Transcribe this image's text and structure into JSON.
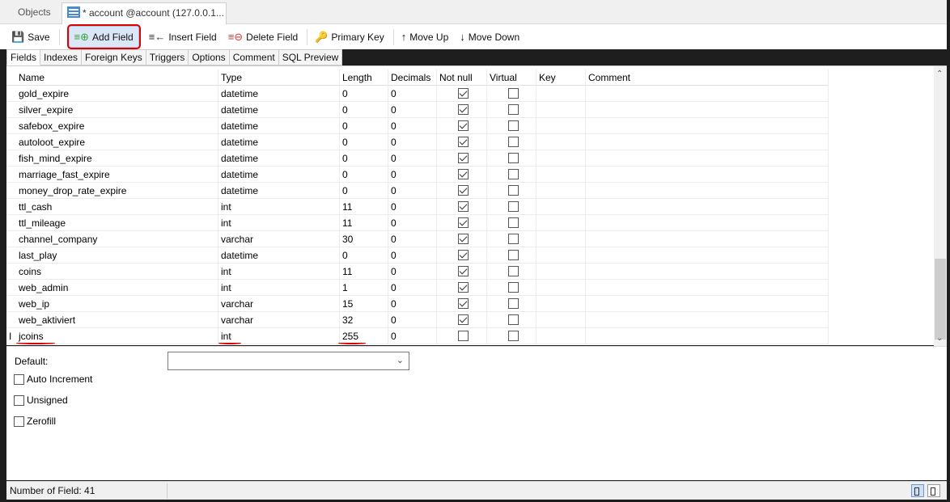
{
  "tabs": {
    "objects_label": "Objects",
    "active_label": "* account @account (127.0.0.1..."
  },
  "toolbar": {
    "save": "Save",
    "add_field": "Add Field",
    "insert_field": "Insert Field",
    "delete_field": "Delete Field",
    "primary_key": "Primary Key",
    "move_up": "Move Up",
    "move_down": "Move Down"
  },
  "subtabs": [
    "Fields",
    "Indexes",
    "Foreign Keys",
    "Triggers",
    "Options",
    "Comment",
    "SQL Preview"
  ],
  "grid": {
    "headers": {
      "name": "Name",
      "type": "Type",
      "length": "Length",
      "decimals": "Decimals",
      "not_null": "Not null",
      "virtual": "Virtual",
      "key": "Key",
      "comment": "Comment"
    },
    "rows": [
      {
        "name": "gold_expire",
        "type": "datetime",
        "length": "0",
        "decimals": "0",
        "not_null": true,
        "virtual": false
      },
      {
        "name": "silver_expire",
        "type": "datetime",
        "length": "0",
        "decimals": "0",
        "not_null": true,
        "virtual": false
      },
      {
        "name": "safebox_expire",
        "type": "datetime",
        "length": "0",
        "decimals": "0",
        "not_null": true,
        "virtual": false
      },
      {
        "name": "autoloot_expire",
        "type": "datetime",
        "length": "0",
        "decimals": "0",
        "not_null": true,
        "virtual": false
      },
      {
        "name": "fish_mind_expire",
        "type": "datetime",
        "length": "0",
        "decimals": "0",
        "not_null": true,
        "virtual": false
      },
      {
        "name": "marriage_fast_expire",
        "type": "datetime",
        "length": "0",
        "decimals": "0",
        "not_null": true,
        "virtual": false
      },
      {
        "name": "money_drop_rate_expire",
        "type": "datetime",
        "length": "0",
        "decimals": "0",
        "not_null": true,
        "virtual": false
      },
      {
        "name": "ttl_cash",
        "type": "int",
        "length": "11",
        "decimals": "0",
        "not_null": true,
        "virtual": false
      },
      {
        "name": "ttl_mileage",
        "type": "int",
        "length": "11",
        "decimals": "0",
        "not_null": true,
        "virtual": false
      },
      {
        "name": "channel_company",
        "type": "varchar",
        "length": "30",
        "decimals": "0",
        "not_null": true,
        "virtual": false
      },
      {
        "name": "last_play",
        "type": "datetime",
        "length": "0",
        "decimals": "0",
        "not_null": true,
        "virtual": false
      },
      {
        "name": "coins",
        "type": "int",
        "length": "11",
        "decimals": "0",
        "not_null": true,
        "virtual": false
      },
      {
        "name": "web_admin",
        "type": "int",
        "length": "1",
        "decimals": "0",
        "not_null": true,
        "virtual": false
      },
      {
        "name": "web_ip",
        "type": "varchar",
        "length": "15",
        "decimals": "0",
        "not_null": true,
        "virtual": false
      },
      {
        "name": "web_aktiviert",
        "type": "varchar",
        "length": "32",
        "decimals": "0",
        "not_null": true,
        "virtual": false
      },
      {
        "name": "jcoins",
        "type": "int",
        "length": "255",
        "decimals": "0",
        "not_null": false,
        "virtual": false
      }
    ],
    "current_row_marker": "I"
  },
  "properties": {
    "default_label": "Default:",
    "default_value": "",
    "auto_increment": "Auto Increment",
    "unsigned": "Unsigned",
    "zerofill": "Zerofill"
  },
  "status": {
    "field_count": "Number of Field: 41"
  }
}
